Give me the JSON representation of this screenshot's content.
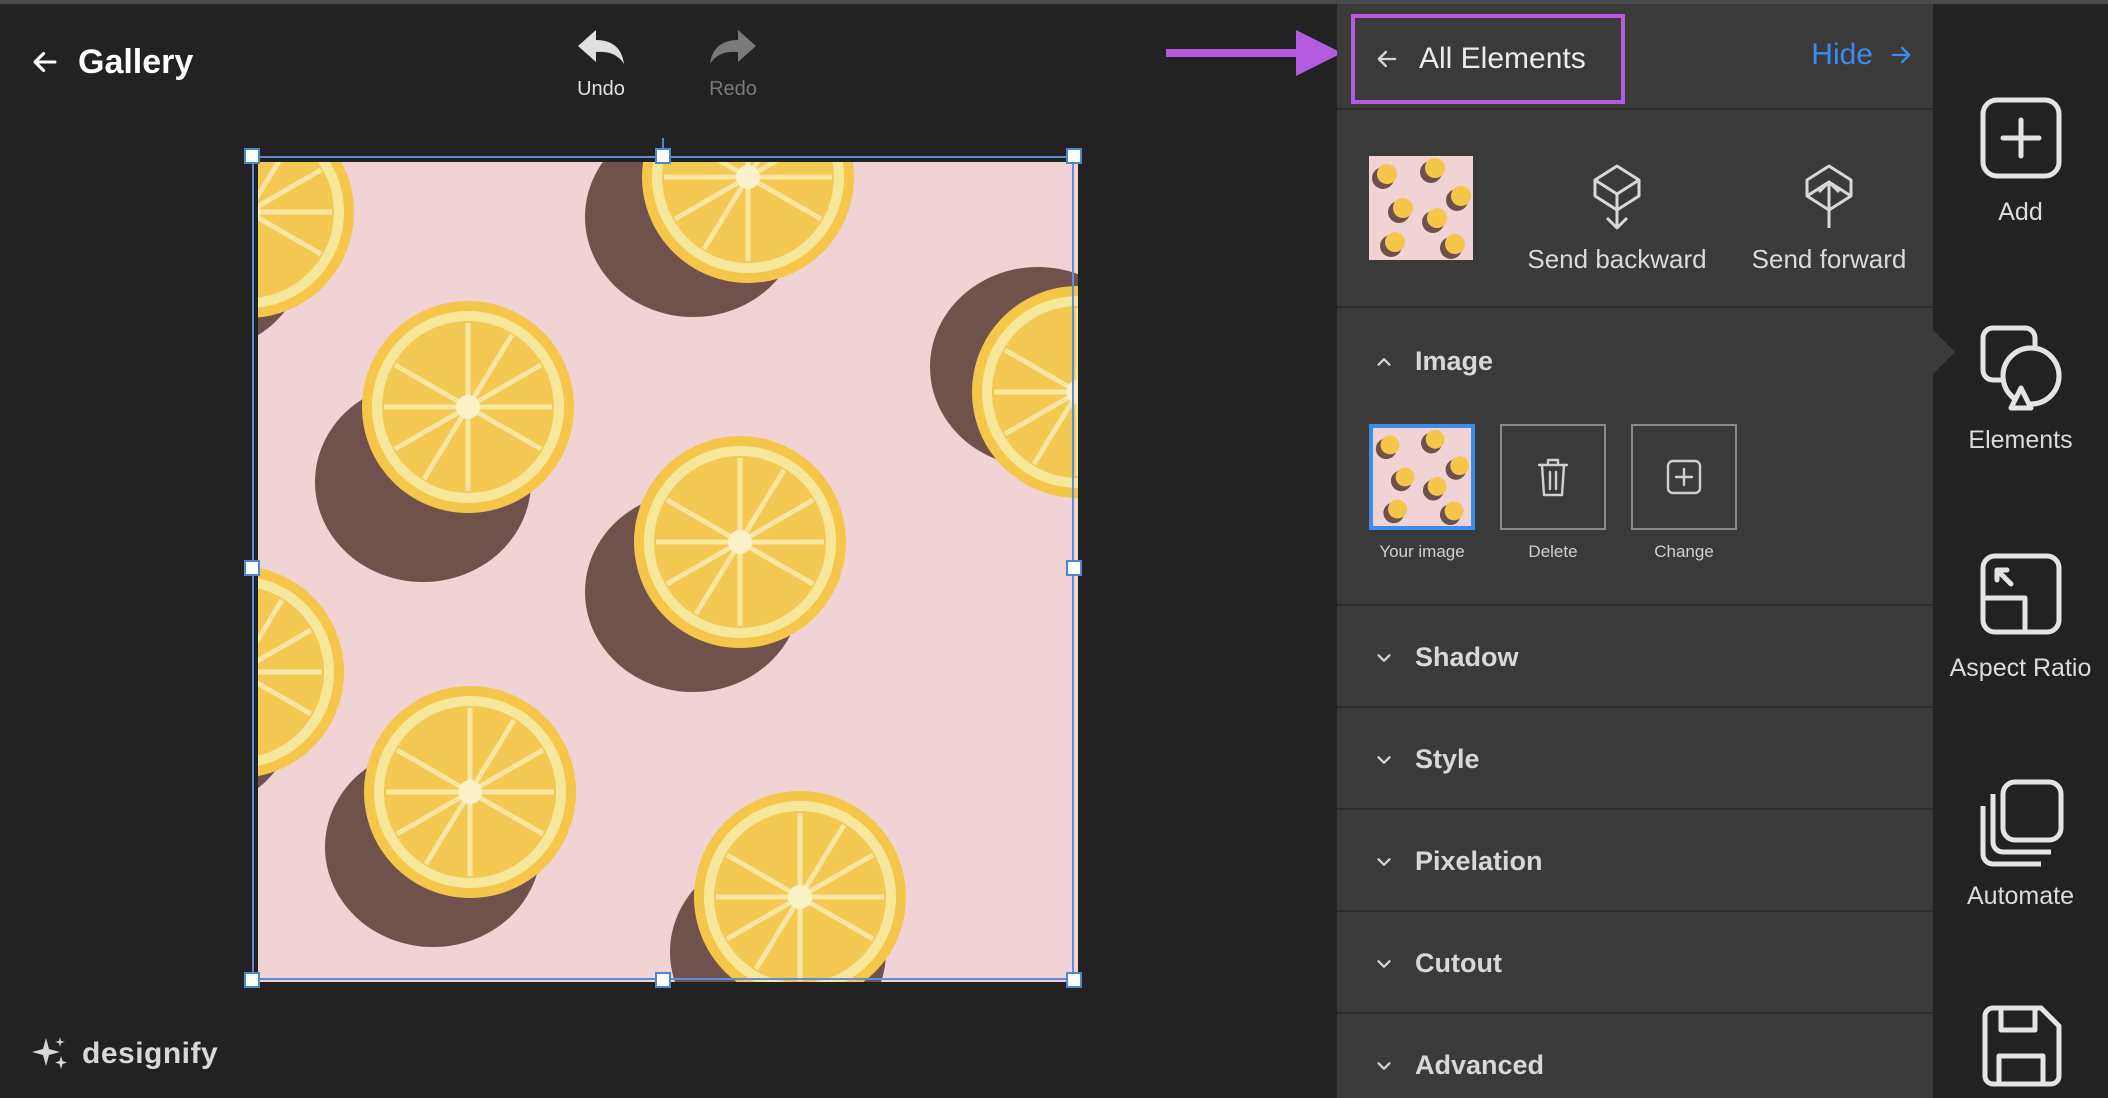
{
  "header": {
    "title": "Gallery",
    "undo_label": "Undo",
    "redo_label": "Redo"
  },
  "canvas": {
    "image_description_icon": "lemon-slices-on-pink-image",
    "background_color": "#f2d6d8",
    "lemon_color": "#f2c94c",
    "selection_color": "#4d86d6"
  },
  "brand": {
    "name": "designify"
  },
  "panel": {
    "back_label": "All Elements",
    "hide_label": "Hide",
    "accent_color": "#3c8cf0",
    "highlight_color": "#b45be0",
    "layer_actions": {
      "send_backward": "Send backward",
      "send_forward": "Send forward"
    },
    "image_section": {
      "title": "Image",
      "tiles": [
        {
          "label": "Your image"
        },
        {
          "label": "Delete"
        },
        {
          "label": "Change"
        }
      ]
    },
    "sections": [
      {
        "title": "Shadow"
      },
      {
        "title": "Style"
      },
      {
        "title": "Pixelation"
      },
      {
        "title": "Cutout"
      },
      {
        "title": "Advanced"
      }
    ]
  },
  "rail": {
    "items": [
      {
        "label": "Add"
      },
      {
        "label": "Elements"
      },
      {
        "label": "Aspect Ratio"
      },
      {
        "label": "Automate"
      }
    ]
  }
}
